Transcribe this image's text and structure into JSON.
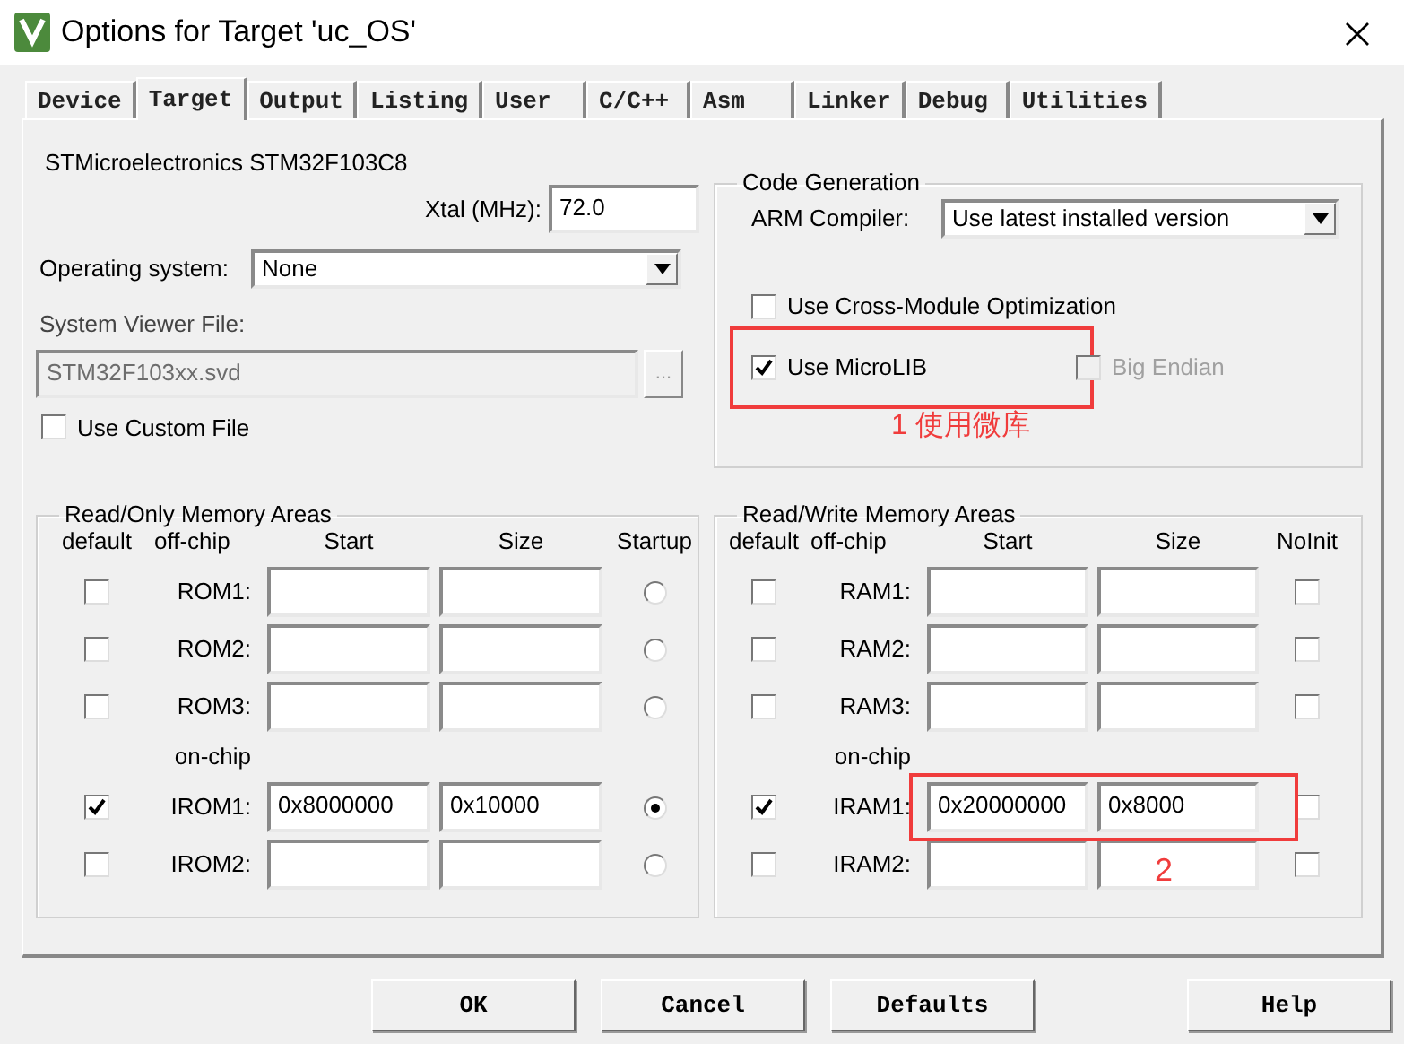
{
  "window": {
    "title": "Options for Target 'uc_OS'"
  },
  "tabs": [
    {
      "label": "Device",
      "selected": false
    },
    {
      "label": "Target",
      "selected": true
    },
    {
      "label": "Output",
      "selected": false
    },
    {
      "label": "Listing",
      "selected": false
    },
    {
      "label": "User",
      "selected": false
    },
    {
      "label": "C/C++",
      "selected": false
    },
    {
      "label": "Asm",
      "selected": false
    },
    {
      "label": "Linker",
      "selected": false
    },
    {
      "label": "Debug",
      "selected": false
    },
    {
      "label": "Utilities",
      "selected": false
    }
  ],
  "device": "STMicroelectronics STM32F103C8",
  "xtal": {
    "label": "Xtal (MHz):",
    "value": "72.0"
  },
  "operating_system": {
    "label": "Operating system:",
    "value": "None"
  },
  "system_viewer": {
    "label": "System Viewer File:",
    "value": "STM32F103xx.svd",
    "disabled": true,
    "browse": "..."
  },
  "use_custom_file": {
    "label": "Use Custom File",
    "checked": false
  },
  "code_generation": {
    "title": "Code Generation",
    "compiler_label": "ARM Compiler:",
    "compiler_value": "Use latest installed version",
    "options": [
      {
        "label": "Use Cross-Module Optimization",
        "checked": false,
        "disabled": false,
        "highlighted": false
      },
      {
        "label": "Use MicroLIB",
        "checked": true,
        "disabled": false,
        "highlighted": true
      },
      {
        "label": "Big Endian",
        "checked": false,
        "disabled": true,
        "highlighted": false
      }
    ],
    "note": "1 使用微库"
  },
  "read_only_memory": {
    "title": "Read/Only Memory Areas",
    "columns": [
      "default",
      "off-chip",
      "Start",
      "Size",
      "Startup"
    ],
    "rows": [
      {
        "kind": "area",
        "label": "ROM1:",
        "default": false,
        "start": "",
        "size": "",
        "selected": false,
        "highlighted": false
      },
      {
        "kind": "area",
        "label": "ROM2:",
        "default": false,
        "start": "",
        "size": "",
        "selected": false,
        "highlighted": false
      },
      {
        "kind": "area",
        "label": "ROM3:",
        "default": false,
        "start": "",
        "size": "",
        "selected": false,
        "highlighted": false
      },
      {
        "kind": "heading",
        "label": "on-chip"
      },
      {
        "kind": "area",
        "label": "IROM1:",
        "default": true,
        "start": "0x8000000",
        "size": "0x10000",
        "selected": true,
        "highlighted": false
      },
      {
        "kind": "area",
        "label": "IROM2:",
        "default": false,
        "start": "",
        "size": "",
        "selected": false,
        "highlighted": false
      }
    ]
  },
  "read_write_memory": {
    "title": "Read/Write Memory Areas",
    "columns": [
      "default",
      "off-chip",
      "Start",
      "Size",
      "NoInit"
    ],
    "rows": [
      {
        "kind": "area",
        "label": "RAM1:",
        "default": false,
        "start": "",
        "size": "",
        "noinit": false,
        "highlighted": false
      },
      {
        "kind": "area",
        "label": "RAM2:",
        "default": false,
        "start": "",
        "size": "",
        "noinit": false,
        "highlighted": false
      },
      {
        "kind": "area",
        "label": "RAM3:",
        "default": false,
        "start": "",
        "size": "",
        "noinit": false,
        "highlighted": false
      },
      {
        "kind": "heading",
        "label": "on-chip"
      },
      {
        "kind": "area",
        "label": "IRAM1:",
        "default": true,
        "start": "0x20000000",
        "size": "0x8000",
        "noinit": false,
        "highlighted": true
      },
      {
        "kind": "area",
        "label": "IRAM2:",
        "default": false,
        "start": "",
        "size": "",
        "noinit": false,
        "highlighted": false
      }
    ],
    "note": "2"
  },
  "buttons": [
    {
      "label": "OK"
    },
    {
      "label": "Cancel"
    },
    {
      "label": "Defaults"
    },
    {
      "label": "Help"
    }
  ]
}
